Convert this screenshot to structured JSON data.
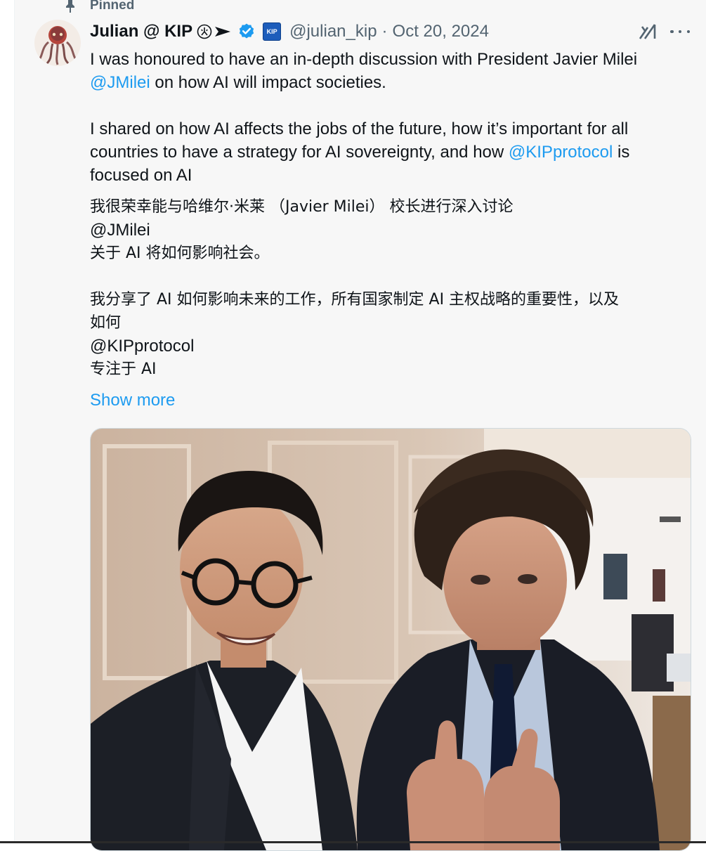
{
  "pin": {
    "label": "Pinned"
  },
  "author": {
    "name": "Julian @ KIP",
    "handle": "@julian_kip",
    "separator": "·",
    "date": "Oct 20, 2024",
    "badge_text": "KIP"
  },
  "tweet": {
    "en_line1": "I was honoured to have an in-depth discussion with President Javier Milei",
    "en_line2_mention": "@JMilei",
    "en_line2_rest": " on how AI will impact societies.",
    "en_line3": "I shared on how AI affects the jobs of the future, how it’s important for all",
    "en_line4_pre": "countries to have a strategy for AI sovereignty, and how ",
    "en_line4_mention": "@KIPprotocol",
    "en_line4_post": " is",
    "en_line5": "focused on AI",
    "cn_line1": "我很荣幸能与哈维尔·米莱 （Javier Milei） 校长进行深入讨论",
    "cn_line2": "@JMilei",
    "cn_line3": "关于 AI 将如何影响社会。",
    "cn_line4": "我分享了 AI 如何影响未来的工作，所有国家制定 AI 主权战略的重要性，以及",
    "cn_line5": "如何",
    "cn_line6": "@KIPprotocol",
    "cn_line7": "专注于 AI"
  },
  "show_more": "Show more",
  "icons": {
    "pin": "pin-icon",
    "verified": "verified-badge-icon",
    "grok": "grok-icon",
    "more": "more-options-icon"
  },
  "colors": {
    "link": "#1d9bf0",
    "secondary_text": "#536471",
    "verified": "#1d9bf0",
    "background": "#f7f7f7"
  }
}
